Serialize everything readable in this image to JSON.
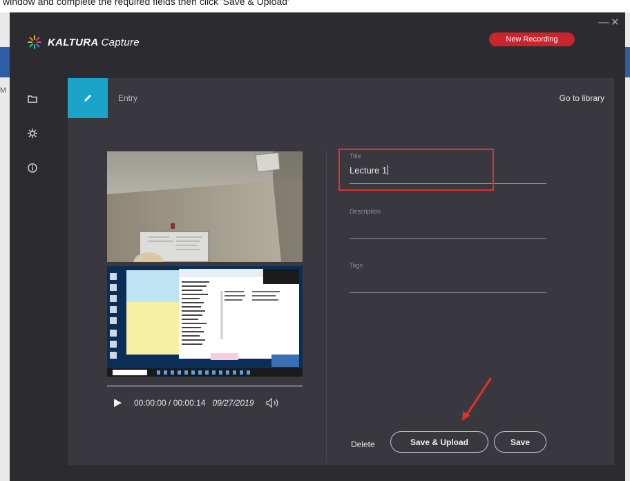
{
  "background": {
    "top_text": "window and complete the required fields then click 'Save & Upload'",
    "left_letter": "M"
  },
  "app": {
    "brand_bold": "KALTURA",
    "brand_light": "Capture",
    "new_recording": "New Recording",
    "minimize": "—",
    "close": "✕"
  },
  "sidebar": {
    "items": [
      {
        "name": "folder-icon"
      },
      {
        "name": "gear-icon"
      },
      {
        "name": "info-icon"
      }
    ]
  },
  "panel": {
    "entry_label": "Entry",
    "go_to_library": "Go to library"
  },
  "player": {
    "timecode": "00:00:00 / 00:00:14",
    "date": "09/27/2019",
    "progress": 0
  },
  "form": {
    "title_label": "Title",
    "title_value": "Lecture 1",
    "description_label": "Description",
    "description_value": "",
    "tags_label": "Tags",
    "tags_value": ""
  },
  "actions": {
    "delete": "Delete",
    "save_upload": "Save & Upload",
    "save": "Save"
  },
  "colors": {
    "accent": "#1ba4c9",
    "record": "#c8252f",
    "annotation": "#e0322f",
    "window_bg": "#2b2b30",
    "panel_bg": "#38383e"
  }
}
